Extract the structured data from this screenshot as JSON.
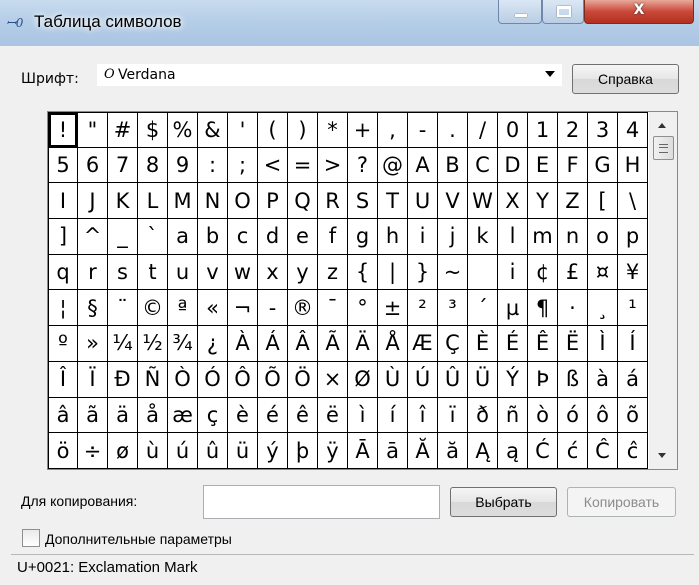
{
  "window": {
    "title": "Таблица символов",
    "app_icon": "ꟷ0",
    "minimize_glyph": "",
    "maximize_glyph": "",
    "close_glyph": "X"
  },
  "font": {
    "label": "Шрифт:",
    "selected_icon": "O",
    "selected": "Verdana"
  },
  "buttons": {
    "help": "Справка",
    "select": "Выбрать",
    "copy": "Копировать"
  },
  "grid": {
    "rows": [
      [
        "!",
        "\"",
        "#",
        "$",
        "%",
        "&",
        "'",
        "(",
        ")",
        "*",
        "+",
        ",",
        "-",
        ".",
        "/",
        "0",
        "1",
        "2",
        "3",
        "4"
      ],
      [
        "5",
        "6",
        "7",
        "8",
        "9",
        ":",
        ";",
        "<",
        "=",
        ">",
        "?",
        "@",
        "A",
        "B",
        "C",
        "D",
        "E",
        "F",
        "G",
        "H"
      ],
      [
        "I",
        "J",
        "K",
        "L",
        "M",
        "N",
        "O",
        "P",
        "Q",
        "R",
        "S",
        "T",
        "U",
        "V",
        "W",
        "X",
        "Y",
        "Z",
        "[",
        "\\"
      ],
      [
        "]",
        "^",
        "_",
        "`",
        "a",
        "b",
        "c",
        "d",
        "e",
        "f",
        "g",
        "h",
        "i",
        "j",
        "k",
        "l",
        "m",
        "n",
        "o",
        "p"
      ],
      [
        "q",
        "r",
        "s",
        "t",
        "u",
        "v",
        "w",
        "x",
        "y",
        "z",
        "{",
        "|",
        "}",
        "~",
        " ",
        "i",
        "¢",
        "£",
        "¤",
        "¥"
      ],
      [
        "¦",
        "§",
        "¨",
        "©",
        "ª",
        "«",
        "¬",
        "-",
        "®",
        "¯",
        "°",
        "±",
        "²",
        "³",
        "´",
        "µ",
        "¶",
        "·",
        "¸",
        "¹"
      ],
      [
        "º",
        "»",
        "¼",
        "½",
        "¾",
        "¿",
        "À",
        "Á",
        "Â",
        "Ã",
        "Ä",
        "Å",
        "Æ",
        "Ç",
        "È",
        "É",
        "Ê",
        "Ë",
        "Ì",
        "Í"
      ],
      [
        "Î",
        "Ï",
        "Ð",
        "Ñ",
        "Ò",
        "Ó",
        "Ô",
        "Õ",
        "Ö",
        "×",
        "Ø",
        "Ù",
        "Ú",
        "Û",
        "Ü",
        "Ý",
        "Þ",
        "ß",
        "à",
        "á"
      ],
      [
        "â",
        "ã",
        "ä",
        "å",
        "æ",
        "ç",
        "è",
        "é",
        "ê",
        "ë",
        "ì",
        "í",
        "î",
        "ï",
        "ð",
        "ñ",
        "ò",
        "ó",
        "ô",
        "õ"
      ],
      [
        "ö",
        "÷",
        "ø",
        "ù",
        "ú",
        "û",
        "ü",
        "ý",
        "þ",
        "ÿ",
        "Ā",
        "ā",
        "Ă",
        "ă",
        "Ą",
        "ą",
        "Ć",
        "ć",
        "Ĉ",
        "ĉ"
      ]
    ],
    "selected": {
      "row": 0,
      "col": 0
    }
  },
  "copy": {
    "label": "Для копирования:",
    "value": ""
  },
  "advanced": {
    "label": "Дополнительные параметры",
    "checked": false
  },
  "status": {
    "text": "U+0021: Exclamation Mark"
  },
  "icons": {
    "minimize": "minimize-icon",
    "maximize": "maximize-icon",
    "close": "close-icon",
    "dropdown": "chevron-down-icon",
    "scroll_up": "arrow-up-icon",
    "scroll_down": "arrow-down-icon"
  },
  "colors": {
    "titlebar": "#b7cfe8",
    "close_button": "#c9483a",
    "window_bg": "#f0f0f0"
  }
}
